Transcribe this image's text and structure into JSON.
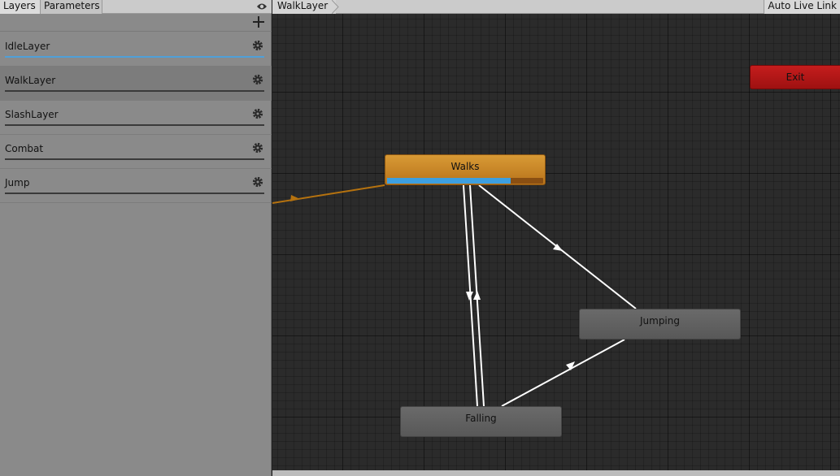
{
  "left_panel": {
    "tabs": [
      {
        "label": "Layers"
      },
      {
        "label": "Parameters"
      }
    ],
    "layers": [
      {
        "label": "IdleLayer"
      },
      {
        "label": "WalkLayer"
      },
      {
        "label": "SlashLayer"
      },
      {
        "label": "Combat"
      },
      {
        "label": "Jump"
      }
    ]
  },
  "graph": {
    "breadcrumb": "WalkLayer",
    "auto_live_link": "Auto Live Link",
    "states": {
      "walks": {
        "label": "Walks",
        "progress": 0.79
      },
      "jumping": {
        "label": "Jumping"
      },
      "falling": {
        "label": "Falling"
      },
      "exit": {
        "label": "Exit"
      }
    }
  },
  "colors": {
    "default_state": "#d89a35",
    "progress": "#3d9fe0",
    "exit_state": "#c51d1d",
    "entry_transition": "#b5720f",
    "transition": "#ffffff"
  }
}
